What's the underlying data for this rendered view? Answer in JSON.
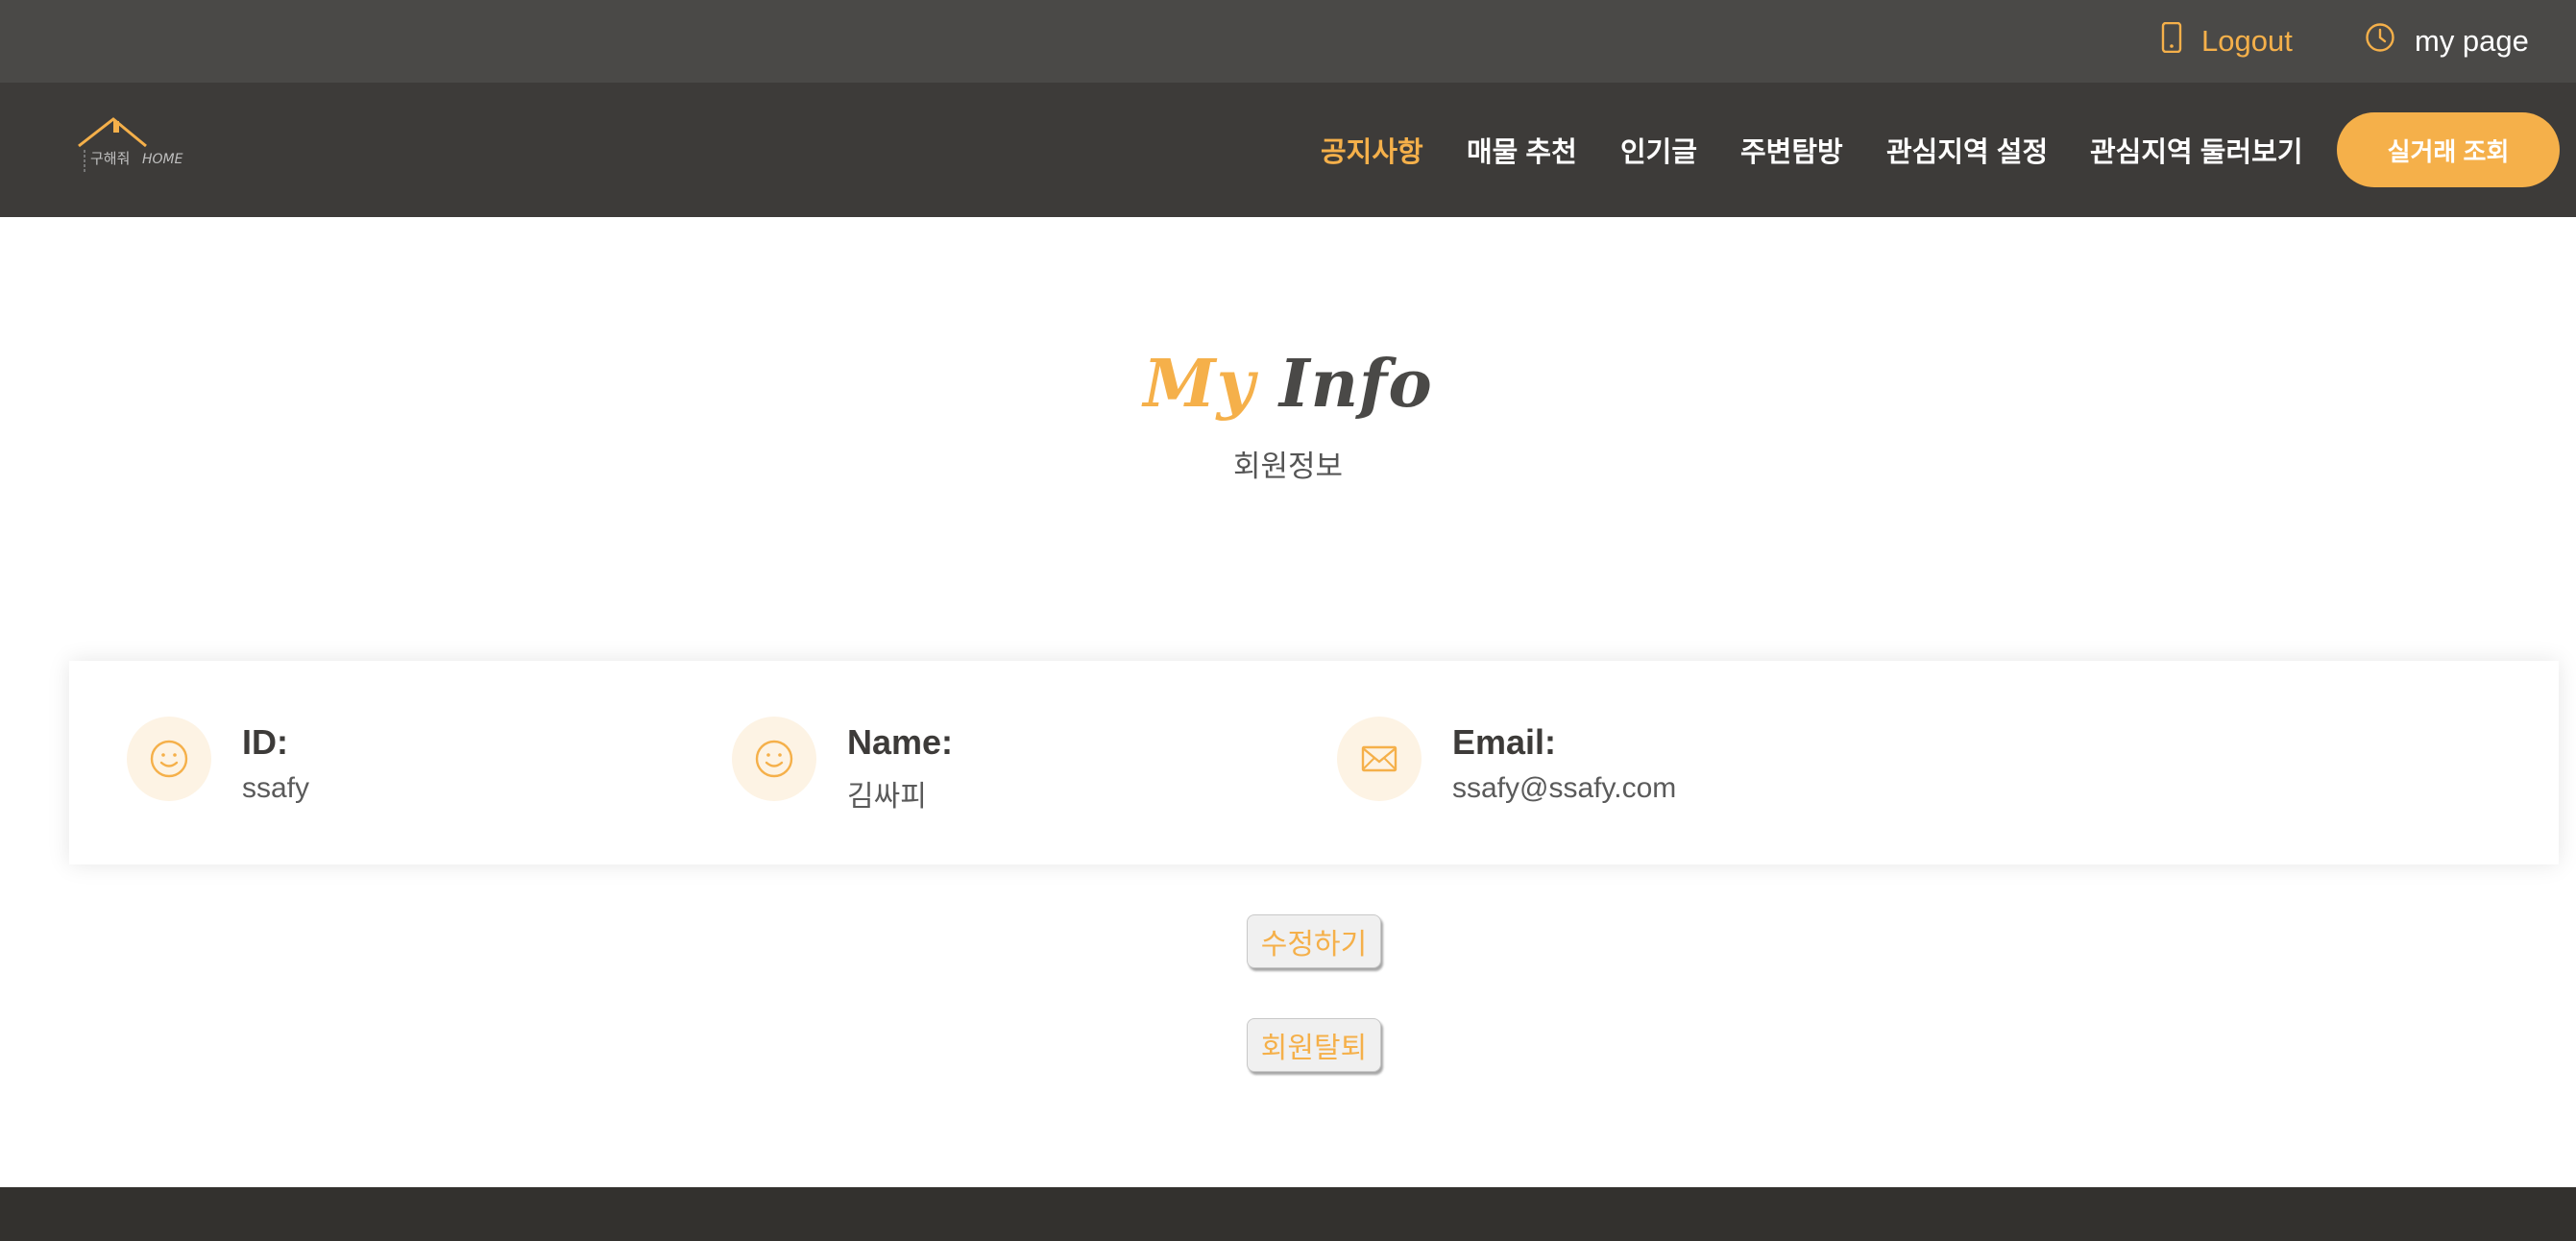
{
  "topbar": {
    "logout_label": "Logout",
    "mypage_label": "my page"
  },
  "logo": {
    "text_ko": "구해줘",
    "text_en": "HOME"
  },
  "nav": {
    "items": [
      "공지사항",
      "매물 추천",
      "인기글",
      "주변탐방",
      "관심지역 설정",
      "관심지역 둘러보기"
    ],
    "active_index": 0,
    "cta_label": "실거래 조회"
  },
  "page": {
    "title_word1": "My",
    "title_word2": "Info",
    "subtitle": "회원정보"
  },
  "profile": {
    "id_label": "ID:",
    "id_value": "ssafy",
    "name_label": "Name:",
    "name_value": "김싸피",
    "email_label": "Email:",
    "email_value": "ssafy@ssafy.com"
  },
  "actions": {
    "edit_label": "수정하기",
    "withdraw_label": "회원탈퇴"
  },
  "colors": {
    "accent": "#f5b04a",
    "topbar": "#4a4947",
    "navbar": "#3d3b39",
    "footer": "#33312e"
  }
}
